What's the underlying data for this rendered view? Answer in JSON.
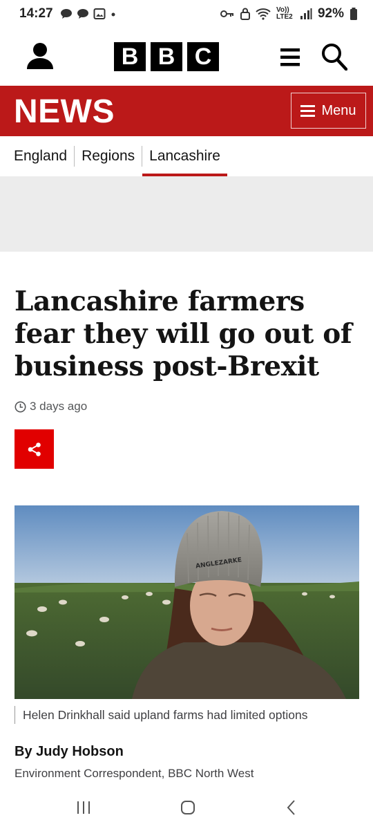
{
  "status_bar": {
    "time": "14:27",
    "battery": "92%",
    "network": "Vo)) LTE2"
  },
  "header": {
    "logo_letters": [
      "B",
      "B",
      "C"
    ]
  },
  "news_bar": {
    "title": "NEWS",
    "menu_label": "Menu",
    "color": "#bb1919"
  },
  "breadcrumb": {
    "items": [
      "England",
      "Regions",
      "Lancashire"
    ],
    "active_index": 2
  },
  "article": {
    "headline": "Lancashire farmers fear they will go out of business post-Brexit",
    "timestamp": "3 days ago",
    "image_caption": "Helen Drinkhall said upland farms had limited options",
    "author": "By Judy Hobson",
    "author_role": "Environment Correspondent, BBC North West",
    "hat_text": "ANGLEZARKE"
  },
  "icons": {
    "account": "account-icon",
    "menu": "hamburger-menu-icon",
    "search": "search-icon",
    "share": "share-icon",
    "clock": "clock-icon"
  }
}
